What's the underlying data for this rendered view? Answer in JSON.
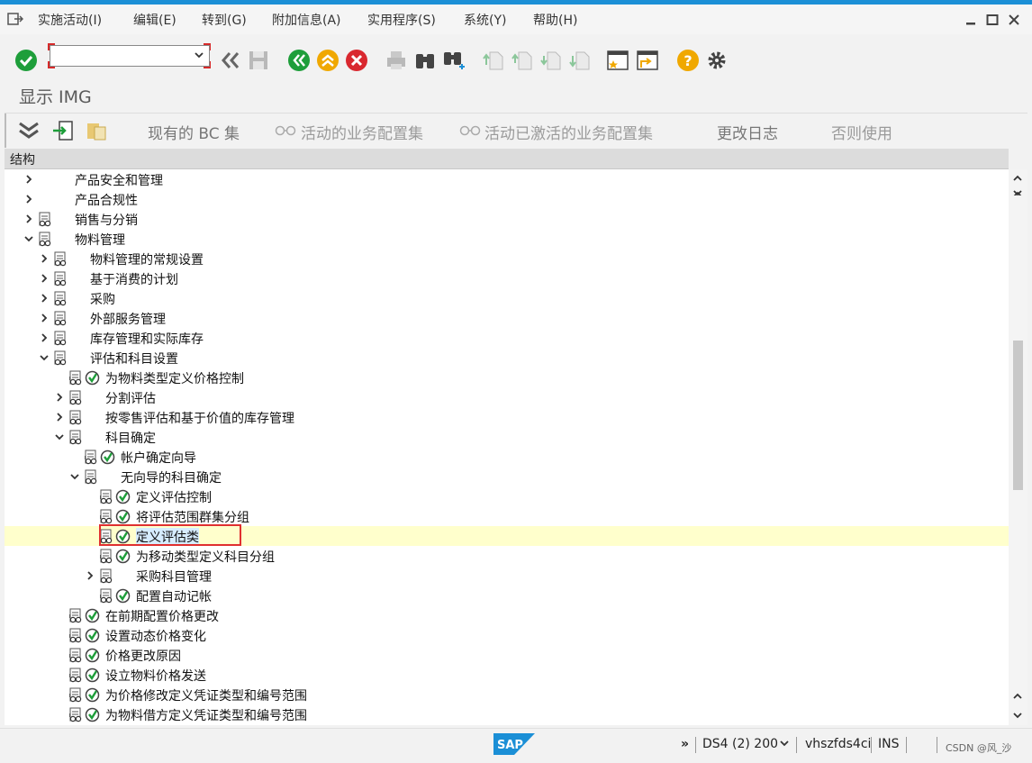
{
  "menubar": {
    "items": [
      "实施活动(I)",
      "编辑(E)",
      "转到(G)",
      "附加信息(A)",
      "实用程序(S)",
      "系统(Y)",
      "帮助(H)"
    ]
  },
  "toolbar": {
    "command_field_value": "",
    "icons": [
      "enter-icon",
      "back-double-icon",
      "save-icon",
      "back-icon",
      "exit-icon",
      "cancel-icon",
      "print-icon",
      "find-icon",
      "find-next-icon",
      "first-page-icon",
      "prev-page-icon",
      "next-page-icon",
      "last-page-icon",
      "new-session-icon",
      "shortcut-icon",
      "help-icon",
      "settings-icon"
    ]
  },
  "title": {
    "text": "显示 IMG"
  },
  "app_toolbar": {
    "buttons": [
      "现有的 BC 集",
      "活动的业务配置集",
      "活动已激活的业务配置集",
      "更改日志",
      "否则使用"
    ]
  },
  "tree": {
    "header": "结构",
    "rows": [
      {
        "label": "产品安全和管理",
        "level": 0,
        "expander": "collapsed",
        "doc": false,
        "exec": false
      },
      {
        "label": "产品合规性",
        "level": 0,
        "expander": "collapsed",
        "doc": false,
        "exec": false
      },
      {
        "label": "销售与分销",
        "level": 0,
        "expander": "collapsed",
        "doc": true,
        "exec": false
      },
      {
        "label": "物料管理",
        "level": 0,
        "expander": "expanded",
        "doc": true,
        "exec": false
      },
      {
        "label": "物料管理的常规设置",
        "level": 1,
        "expander": "collapsed",
        "doc": true,
        "exec": false
      },
      {
        "label": "基于消费的计划",
        "level": 1,
        "expander": "collapsed",
        "doc": true,
        "exec": false
      },
      {
        "label": "采购",
        "level": 1,
        "expander": "collapsed",
        "doc": true,
        "exec": false
      },
      {
        "label": "外部服务管理",
        "level": 1,
        "expander": "collapsed",
        "doc": true,
        "exec": false
      },
      {
        "label": "库存管理和实际库存",
        "level": 1,
        "expander": "collapsed",
        "doc": true,
        "exec": false
      },
      {
        "label": "评估和科目设置",
        "level": 1,
        "expander": "expanded",
        "doc": true,
        "exec": false
      },
      {
        "label": "为物料类型定义价格控制",
        "level": 2,
        "expander": "leaf",
        "doc": true,
        "exec": true
      },
      {
        "label": "分割评估",
        "level": 2,
        "expander": "collapsed",
        "doc": true,
        "exec": false
      },
      {
        "label": "按零售评估和基于价值的库存管理",
        "level": 2,
        "expander": "collapsed",
        "doc": true,
        "exec": false
      },
      {
        "label": "科目确定",
        "level": 2,
        "expander": "expanded",
        "doc": true,
        "exec": false
      },
      {
        "label": "帐户确定向导",
        "level": 3,
        "expander": "leaf",
        "doc": true,
        "exec": true
      },
      {
        "label": "无向导的科目确定",
        "level": 3,
        "expander": "expanded",
        "doc": true,
        "exec": false
      },
      {
        "label": "定义评估控制",
        "level": 4,
        "expander": "leaf",
        "doc": true,
        "exec": true
      },
      {
        "label": "将评估范围群集分组",
        "level": 4,
        "expander": "leaf",
        "doc": true,
        "exec": true
      },
      {
        "label": "定义评估类",
        "level": 4,
        "expander": "leaf",
        "doc": true,
        "exec": true,
        "selected": true
      },
      {
        "label": "为移动类型定义科目分组",
        "level": 4,
        "expander": "leaf",
        "doc": true,
        "exec": true
      },
      {
        "label": "采购科目管理",
        "level": 4,
        "expander": "collapsed",
        "doc": true,
        "exec": false
      },
      {
        "label": "配置自动记帐",
        "level": 4,
        "expander": "leaf",
        "doc": true,
        "exec": true
      },
      {
        "label": "在前期配置价格更改",
        "level": 2,
        "expander": "leaf",
        "doc": true,
        "exec": true
      },
      {
        "label": "设置动态价格变化",
        "level": 2,
        "expander": "leaf",
        "doc": true,
        "exec": true
      },
      {
        "label": "价格更改原因",
        "level": 2,
        "expander": "leaf",
        "doc": true,
        "exec": true
      },
      {
        "label": "设立物料价格发送",
        "level": 2,
        "expander": "leaf",
        "doc": true,
        "exec": true
      },
      {
        "label": "为价格修改定义凭证类型和编号范围",
        "level": 2,
        "expander": "leaf",
        "doc": true,
        "exec": true
      },
      {
        "label": "为物料借方定义凭证类型和编号范围",
        "level": 2,
        "expander": "leaf",
        "doc": true,
        "exec": true
      }
    ]
  },
  "status": {
    "logo": "SAP",
    "system": "DS4 (2) 200",
    "server": "vhszfds4ci",
    "mode": "INS",
    "watermark": "CSDN @风_沙"
  },
  "colors": {
    "accent": "#1b8fd6",
    "selected_row": "#ffffcc",
    "highlight_box": "#e03030",
    "exec_green": "#1e9e3a"
  }
}
